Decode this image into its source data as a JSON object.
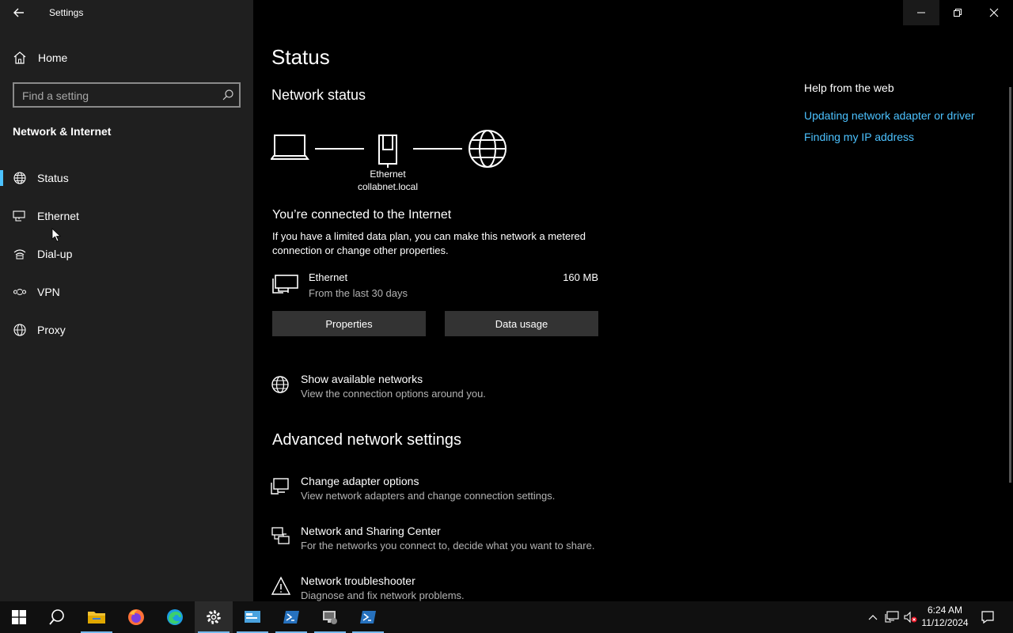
{
  "window": {
    "app_title": "Settings"
  },
  "sidebar": {
    "home_label": "Home",
    "search_placeholder": "Find a setting",
    "section_title": "Network & Internet",
    "items": [
      {
        "label": "Status",
        "icon": "globe-icon",
        "active": true
      },
      {
        "label": "Ethernet",
        "icon": "ethernet-icon",
        "active": false
      },
      {
        "label": "Dial-up",
        "icon": "dialup-icon",
        "active": false
      },
      {
        "label": "VPN",
        "icon": "vpn-icon",
        "active": false
      },
      {
        "label": "Proxy",
        "icon": "globe-icon",
        "active": false
      }
    ]
  },
  "main": {
    "title": "Status",
    "network_status_heading": "Network status",
    "topology": {
      "adapter_name": "Ethernet",
      "network_name": "collabnet.local"
    },
    "connected_heading": "You’re connected to the Internet",
    "connected_description": "If you have a limited data plan, you can make this network a metered connection or change other properties.",
    "connection": {
      "name": "Ethernet",
      "period": "From the last 30 days",
      "usage": "160 MB"
    },
    "buttons": {
      "properties": "Properties",
      "data_usage": "Data usage"
    },
    "show_networks": {
      "title": "Show available networks",
      "description": "View the connection options around you."
    },
    "advanced_heading": "Advanced network settings",
    "advanced_items": [
      {
        "title": "Change adapter options",
        "description": "View network adapters and change connection settings."
      },
      {
        "title": "Network and Sharing Center",
        "description": "For the networks you connect to, decide what you want to share."
      },
      {
        "title": "Network troubleshooter",
        "description": "Diagnose and fix network problems."
      }
    ]
  },
  "help": {
    "title": "Help from the web",
    "links": [
      "Updating network adapter or driver",
      "Finding my IP address"
    ]
  },
  "taskbar": {
    "time": "6:24 AM",
    "date": "11/12/2024"
  },
  "colors": {
    "accent": "#4cc2ff",
    "sidebar_bg": "#1f1f1f",
    "main_bg": "#000000",
    "button_bg": "#333333"
  }
}
